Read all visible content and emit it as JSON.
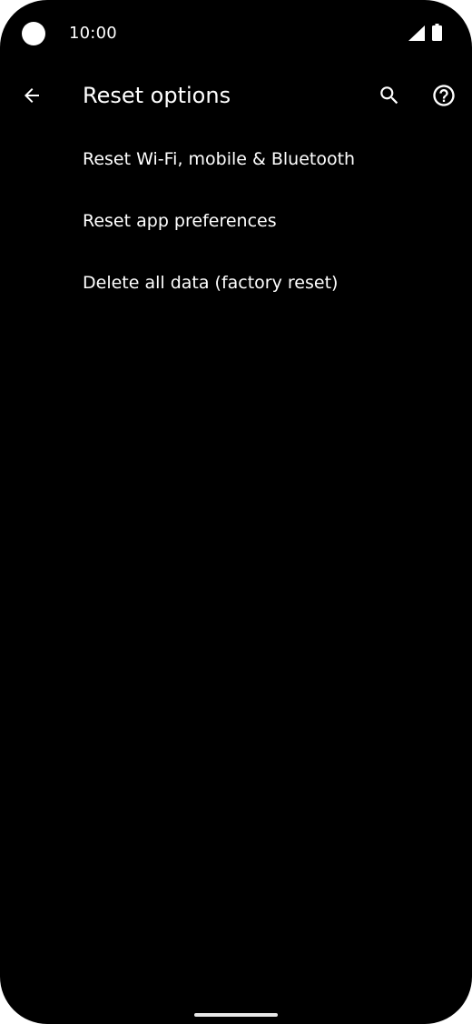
{
  "status_bar": {
    "time": "10:00",
    "icons": [
      "camera-cutout",
      "signal-icon",
      "battery-icon"
    ]
  },
  "app_bar": {
    "title": "Reset options",
    "back_icon": "arrow-back-icon",
    "search_icon": "search-icon",
    "help_icon": "help-circle-icon"
  },
  "options": [
    {
      "label": "Reset Wi-Fi, mobile & Bluetooth"
    },
    {
      "label": "Reset app preferences"
    },
    {
      "label": "Delete all data (factory reset)"
    }
  ],
  "colors": {
    "background": "#000000",
    "text": "#ffffff"
  }
}
